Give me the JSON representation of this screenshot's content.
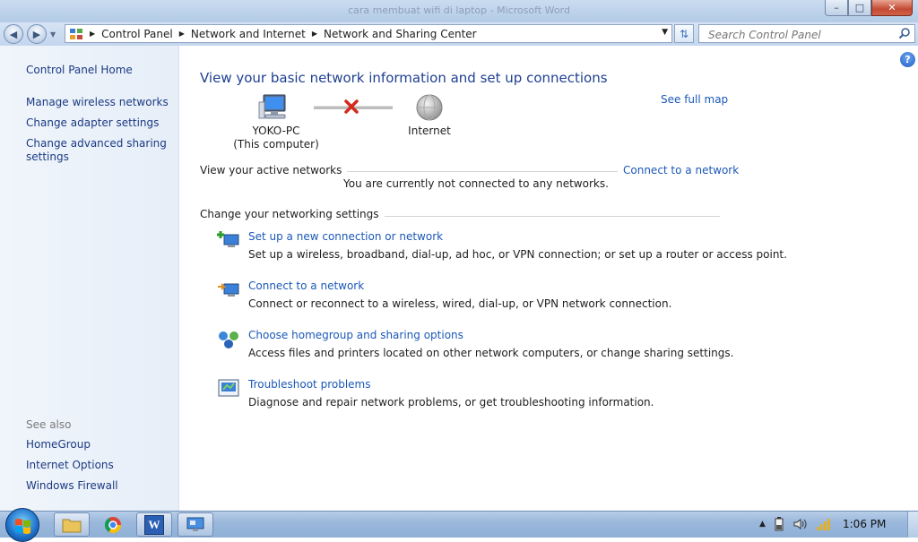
{
  "window": {
    "title": "cara membuat wifi di laptop - Microsoft Word",
    "controls": {
      "minimize": "–",
      "maximize": "□",
      "close": "✕"
    }
  },
  "address_bar": {
    "crumbs": [
      "Control Panel",
      "Network and Internet",
      "Network and Sharing Center"
    ],
    "search_placeholder": "Search Control Panel"
  },
  "sidebar": {
    "home": "Control Panel Home",
    "items": [
      "Manage wireless networks",
      "Change adapter settings",
      "Change advanced sharing settings"
    ],
    "see_also_heading": "See also",
    "see_also": [
      "HomeGroup",
      "Internet Options",
      "Windows Firewall"
    ]
  },
  "main": {
    "title": "View your basic network information and set up connections",
    "see_full_map": "See full map",
    "computer_name": "YOKO-PC",
    "computer_sub": "(This computer)",
    "internet_label": "Internet",
    "active_networks_heading": "View your active networks",
    "connect_link": "Connect to a network",
    "not_connected": "You are currently not connected to any networks.",
    "settings_heading": "Change your networking settings",
    "tasks": [
      {
        "link": "Set up a new connection or network",
        "desc": "Set up a wireless, broadband, dial-up, ad hoc, or VPN connection; or set up a router or access point."
      },
      {
        "link": "Connect to a network",
        "desc": "Connect or reconnect to a wireless, wired, dial-up, or VPN network connection."
      },
      {
        "link": "Choose homegroup and sharing options",
        "desc": "Access files and printers located on other network computers, or change sharing settings."
      },
      {
        "link": "Troubleshoot problems",
        "desc": "Diagnose and repair network problems, or get troubleshooting information."
      }
    ]
  },
  "taskbar": {
    "clock": "1:06 PM",
    "word_letter": "W"
  },
  "colors": {
    "link": "#1b58b8",
    "title": "#1e3f91",
    "sidebar_link": "#1b3a82"
  }
}
